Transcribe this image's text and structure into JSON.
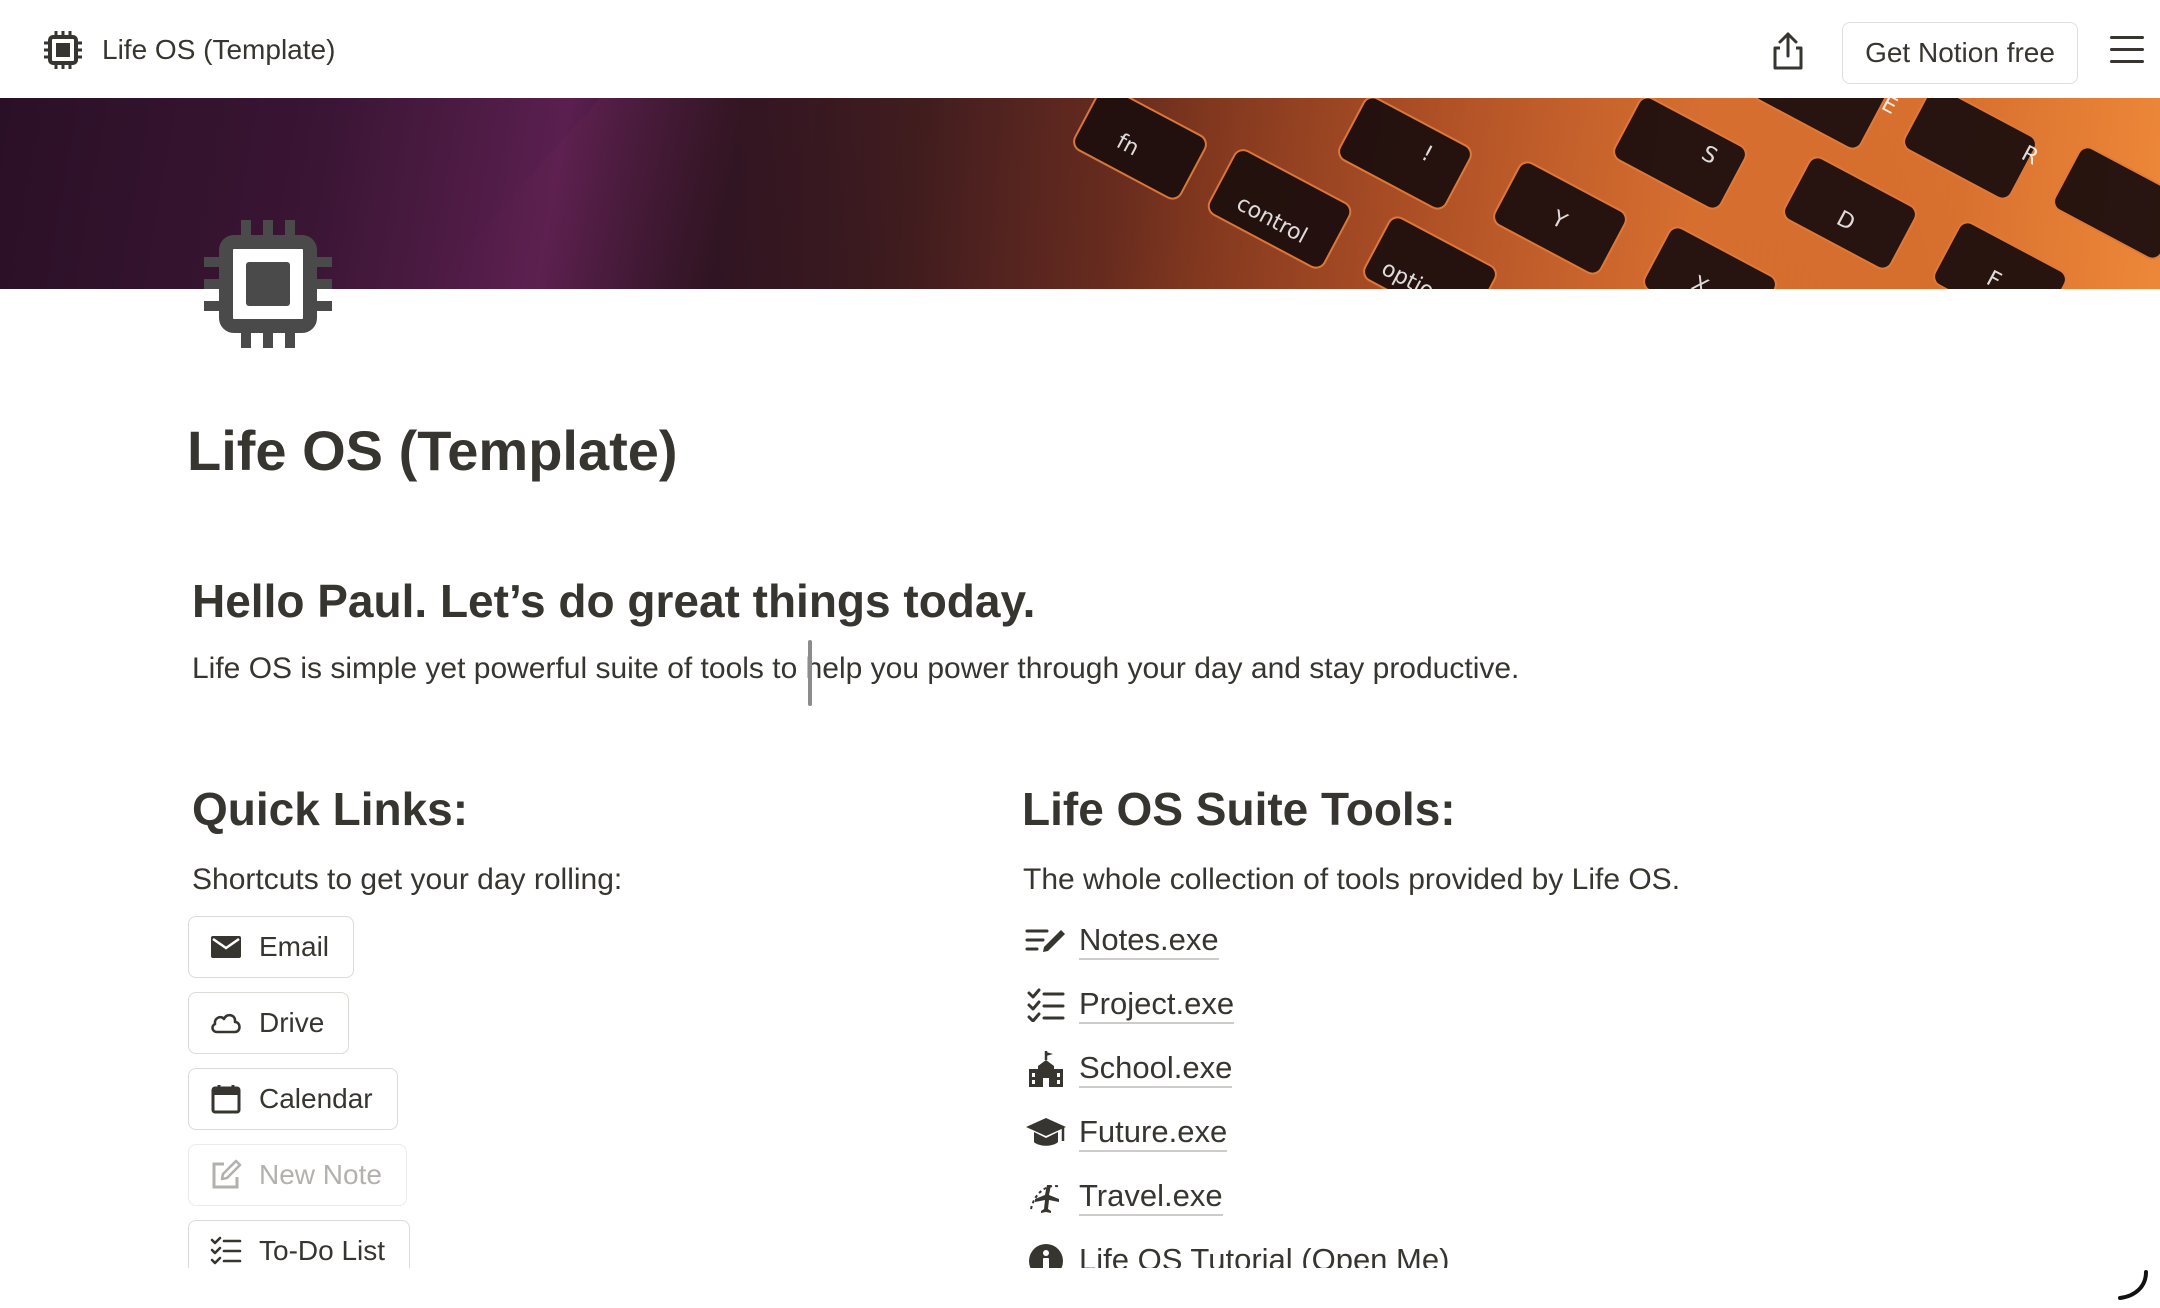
{
  "topbar": {
    "page_title": "Life OS (Template)",
    "cta_label": "Get Notion free",
    "icons": {
      "page": "chip-icon",
      "share": "share-icon",
      "menu": "hamburger-menu-icon"
    }
  },
  "cover": {
    "description_icon": "keyboard-cover-image"
  },
  "page": {
    "title": "Life OS (Template)",
    "greeting": "Hello Paul. Let’s do great things today.",
    "intro": "Life OS is simple yet powerful suite of tools to help you power through your day and stay productive."
  },
  "quick_links": {
    "heading": "Quick Links:",
    "subtitle": "Shortcuts to get your day rolling:",
    "buttons": [
      {
        "label": "Email",
        "icon": "envelope-icon",
        "disabled": false
      },
      {
        "label": "Drive",
        "icon": "cloud-icon",
        "disabled": false
      },
      {
        "label": "Calendar",
        "icon": "calendar-icon",
        "disabled": false
      },
      {
        "label": "New Note",
        "icon": "edit-note-icon",
        "disabled": true
      },
      {
        "label": "To-Do List",
        "icon": "checklist-icon",
        "disabled": false
      }
    ]
  },
  "suite_tools": {
    "heading": "Life OS Suite Tools:",
    "subtitle": "The whole collection of tools provided by Life OS.",
    "links": [
      {
        "label": "Notes.exe",
        "icon": "notes-pen-icon"
      },
      {
        "label": "Project.exe",
        "icon": "checklist-icon"
      },
      {
        "label": "School.exe",
        "icon": "school-icon"
      },
      {
        "label": "Future.exe",
        "icon": "graduation-cap-icon"
      },
      {
        "label": "Travel.exe",
        "icon": "airplane-icon"
      },
      {
        "label": "Life OS Tutorial (Open Me)",
        "icon": "info-icon"
      }
    ]
  },
  "colors": {
    "text": "#37352f",
    "muted": "#b3b1ad",
    "border": "#dcdad6"
  }
}
